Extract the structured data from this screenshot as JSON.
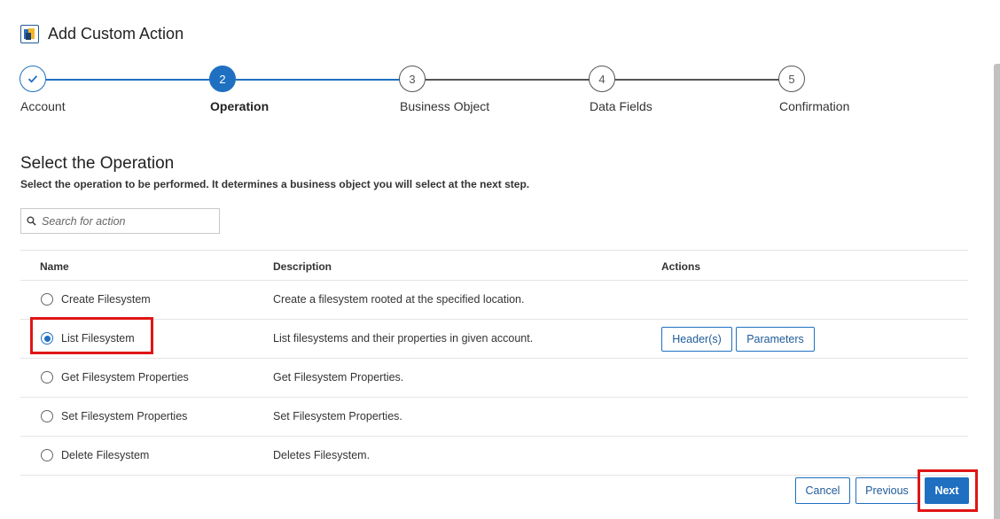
{
  "header": {
    "title": "Add Custom Action"
  },
  "stepper": {
    "steps": [
      {
        "number": "",
        "label": "Account",
        "state": "done"
      },
      {
        "number": "2",
        "label": "Operation",
        "state": "active"
      },
      {
        "number": "3",
        "label": "Business Object",
        "state": "todo"
      },
      {
        "number": "4",
        "label": "Data Fields",
        "state": "todo"
      },
      {
        "number": "5",
        "label": "Confirmation",
        "state": "todo"
      }
    ]
  },
  "section": {
    "title": "Select the Operation",
    "subtitle": "Select the operation to be performed. It determines a business object you will select at the next step."
  },
  "search": {
    "placeholder": "Search for action",
    "value": ""
  },
  "table": {
    "columns": [
      "Name",
      "Description",
      "Actions"
    ],
    "rows": [
      {
        "name": "Create Filesystem",
        "description": "Create a filesystem rooted at the specified location.",
        "selected": false
      },
      {
        "name": "List Filesystem",
        "description": "List filesystems and their properties in given account.",
        "selected": true
      },
      {
        "name": "Get Filesystem Properties",
        "description": "Get Filesystem Properties.",
        "selected": false
      },
      {
        "name": "Set Filesystem Properties",
        "description": "Set Filesystem Properties.",
        "selected": false
      },
      {
        "name": "Delete Filesystem",
        "description": "Deletes Filesystem.",
        "selected": false
      }
    ],
    "row_actions": {
      "headers_label": "Header(s)",
      "parameters_label": "Parameters"
    }
  },
  "footer": {
    "cancel_label": "Cancel",
    "previous_label": "Previous",
    "next_label": "Next"
  },
  "colors": {
    "accent": "#1f70c1",
    "highlight": "#e01515"
  },
  "icons": {
    "app": "custom-action-app-icon",
    "search": "search-icon",
    "check": "check-icon"
  }
}
